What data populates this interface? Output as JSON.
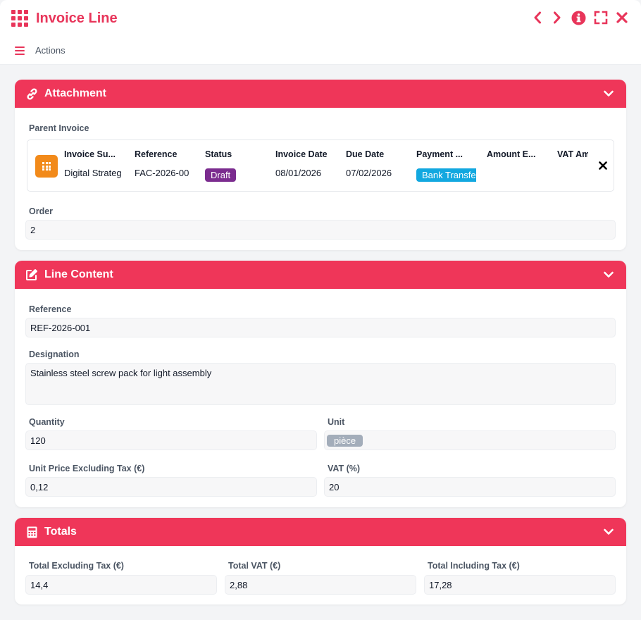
{
  "window": {
    "title": "Invoice Line"
  },
  "toolbar": {
    "actions_label": "Actions"
  },
  "colors": {
    "accent": "#e8355a",
    "panel_header": "#ef3659",
    "draft_badge": "#7b2c8f",
    "payment_badge": "#12a8e0",
    "unit_badge": "#a3adba",
    "ref_icon": "#f28a1a"
  },
  "attachment": {
    "title": "Attachment",
    "parent_invoice": {
      "label": "Parent Invoice",
      "columns": [
        "Invoice Su...",
        "Reference",
        "Status",
        "Invoice Date",
        "Due Date",
        "Payment ...",
        "Amount E...",
        "VAT Am"
      ],
      "values": {
        "subject": "Digital Strateg",
        "reference": "FAC-2026-00",
        "status": "Draft",
        "invoice_date": "08/01/2026",
        "due_date": "07/02/2026",
        "payment": "Bank Transfe"
      }
    },
    "order": {
      "label": "Order",
      "value": "2"
    }
  },
  "line_content": {
    "title": "Line Content",
    "reference": {
      "label": "Reference",
      "value": "REF-2026-001"
    },
    "designation": {
      "label": "Designation",
      "value": "Stainless steel screw pack for light assembly"
    },
    "quantity": {
      "label": "Quantity",
      "value": "120"
    },
    "unit": {
      "label": "Unit",
      "value": "pièce"
    },
    "unit_price": {
      "label": "Unit Price Excluding Tax (€)",
      "value": "0,12"
    },
    "vat": {
      "label": "VAT (%)",
      "value": "20"
    }
  },
  "totals": {
    "title": "Totals",
    "total_excl": {
      "label": "Total Excluding Tax (€)",
      "value": "14,4"
    },
    "total_vat": {
      "label": "Total VAT (€)",
      "value": "2,88"
    },
    "total_incl": {
      "label": "Total Including Tax (€)",
      "value": "17,28"
    }
  }
}
